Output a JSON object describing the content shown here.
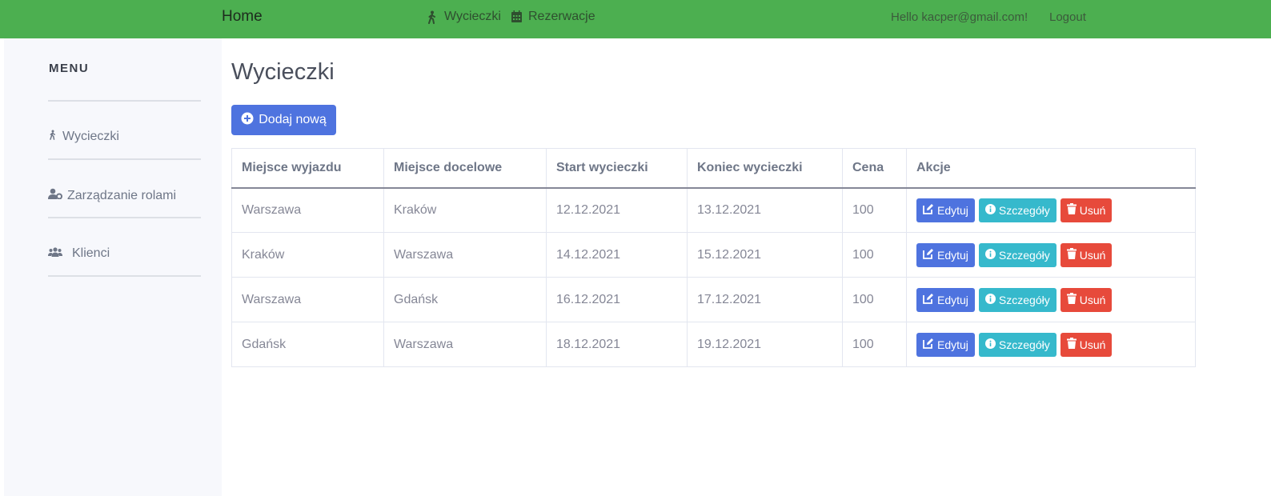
{
  "nav": {
    "brand": "Home",
    "links": [
      {
        "label": "Wycieczki",
        "icon": "hiking-icon"
      },
      {
        "label": "Rezerwacje",
        "icon": "calendar-icon"
      }
    ],
    "greeting": "Hello kacper@gmail.com!",
    "logout": "Logout"
  },
  "sidebar": {
    "title": "MENU",
    "items": [
      {
        "label": "Wycieczki",
        "icon": "hiking-icon"
      },
      {
        "label": "Zarządzanie rolami",
        "icon": "user-cog-icon"
      },
      {
        "label": "Klienci",
        "icon": "users-icon"
      }
    ]
  },
  "main": {
    "title": "Wycieczki",
    "add_button": "Dodaj nową",
    "table": {
      "headers": [
        "Miejsce wyjazdu",
        "Miejsce docelowe",
        "Start wycieczki",
        "Koniec wycieczki",
        "Cena",
        "Akcje"
      ],
      "rows": [
        [
          "Warszawa",
          "Kraków",
          "12.12.2021",
          "13.12.2021",
          "100"
        ],
        [
          "Kraków",
          "Warszawa",
          "14.12.2021",
          "15.12.2021",
          "100"
        ],
        [
          "Warszawa",
          "Gdańsk",
          "16.12.2021",
          "17.12.2021",
          "100"
        ],
        [
          "Gdańsk",
          "Warszawa",
          "18.12.2021",
          "19.12.2021",
          "100"
        ]
      ],
      "actions": {
        "edit": "Edytuj",
        "details": "Szczegóły",
        "delete": "Usuń"
      }
    }
  },
  "colors": {
    "navbar": "#4caf50",
    "primary": "#4e73df",
    "info": "#36b9cc",
    "danger": "#e74a3b",
    "sidebar_bg": "#f7f8fc"
  }
}
